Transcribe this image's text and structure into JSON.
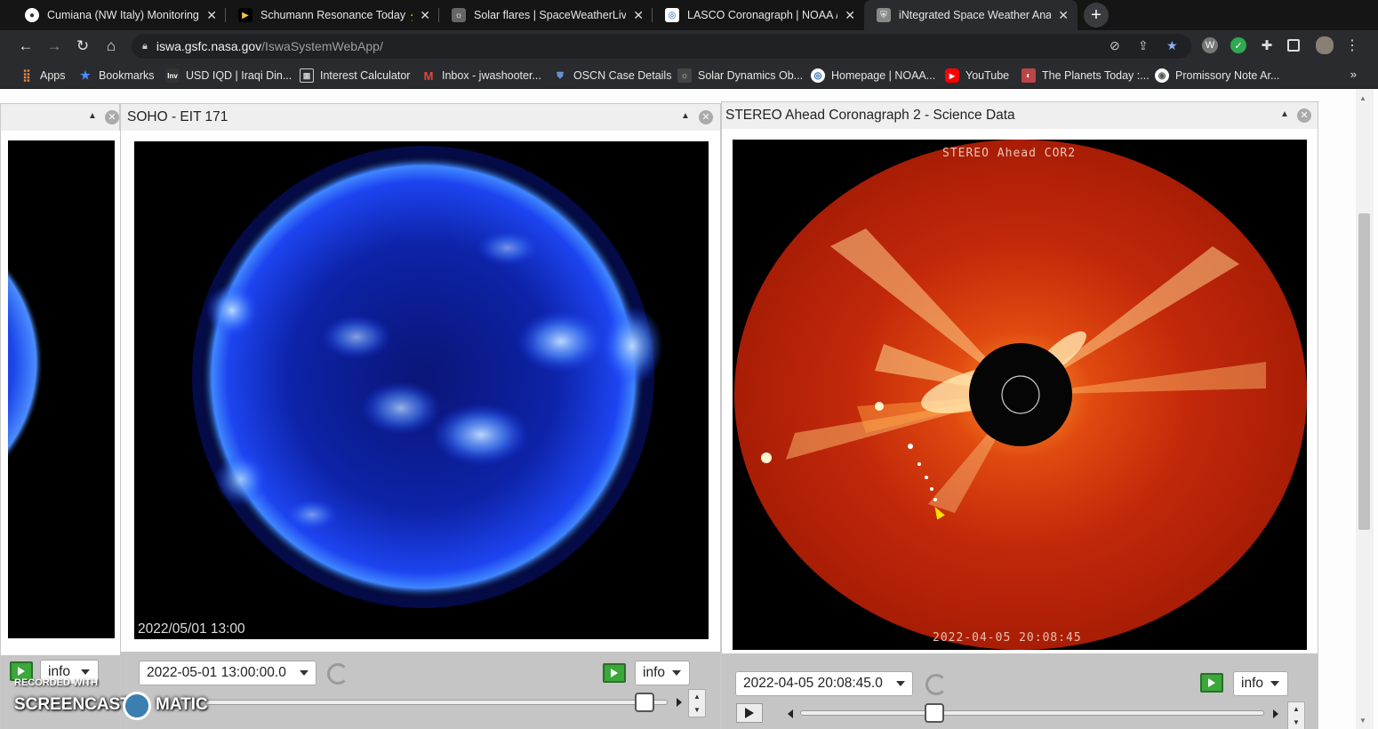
{
  "browser": {
    "tabs": [
      {
        "title": "Cumiana (NW Italy) Monitoring S",
        "favicon": "globe-icon"
      },
      {
        "title": "Schumann Resonance Today ⚡",
        "favicon": "schumann-icon"
      },
      {
        "title": "Solar flares | SpaceWeatherLive.c",
        "favicon": "spaceweatherlive-icon"
      },
      {
        "title": "LASCO Coronagraph | NOAA / N",
        "favicon": "noaa-icon"
      },
      {
        "title": "iNtegrated Space Weather Analy",
        "favicon": "iswa-icon"
      }
    ],
    "address": {
      "domain": "iswa.gsfc.nasa.gov",
      "path": "/IswaSystemWebApp/"
    },
    "bookmarks": [
      {
        "label": "Apps",
        "icon": "apps-grid-icon"
      },
      {
        "label": "Bookmarks",
        "icon": "star-icon"
      },
      {
        "label": "USD IQD | Iraqi Din...",
        "icon": "inv-icon"
      },
      {
        "label": "Interest Calculator",
        "icon": "calculator-icon"
      },
      {
        "label": "Inbox - jwashooter...",
        "icon": "gmail-icon"
      },
      {
        "label": "OSCN Case Details",
        "icon": "oscn-icon"
      },
      {
        "label": "Solar Dynamics Ob...",
        "icon": "sdo-icon"
      },
      {
        "label": "Homepage | NOAA...",
        "icon": "noaa-icon"
      },
      {
        "label": "YouTube",
        "icon": "youtube-icon"
      },
      {
        "label": "The Planets Today :...",
        "icon": "planets-icon"
      },
      {
        "label": "Promissory Note Ar...",
        "icon": "document-icon"
      }
    ],
    "bookmarks_more": "»"
  },
  "panels": {
    "soho": {
      "title": "SOHO - EIT 171",
      "image_timestamp": "2022/05/01 13:00",
      "date_value": "2022-05-01 13:00:00.0",
      "info_label": "info",
      "slider_position": 0.95
    },
    "stereo": {
      "title": "STEREO Ahead Coronagraph 2 - Science Data",
      "image_caption": "STEREO Ahead COR2",
      "image_timestamp": "2022-04-05 20:08:45",
      "date_value": "2022-04-05 20:08:45.0",
      "info_label": "info",
      "slider_position": 0.29
    },
    "left": {
      "info_label": "info"
    }
  },
  "watermark": {
    "line1": "RECORDED WITH",
    "line2a": "SCREENCAST",
    "line2b": "MATIC"
  },
  "colors": {
    "soho_sun": "#1a3fff",
    "stereo_disk": "#c42a0a",
    "chrome_dark": "#2a2b2f"
  }
}
